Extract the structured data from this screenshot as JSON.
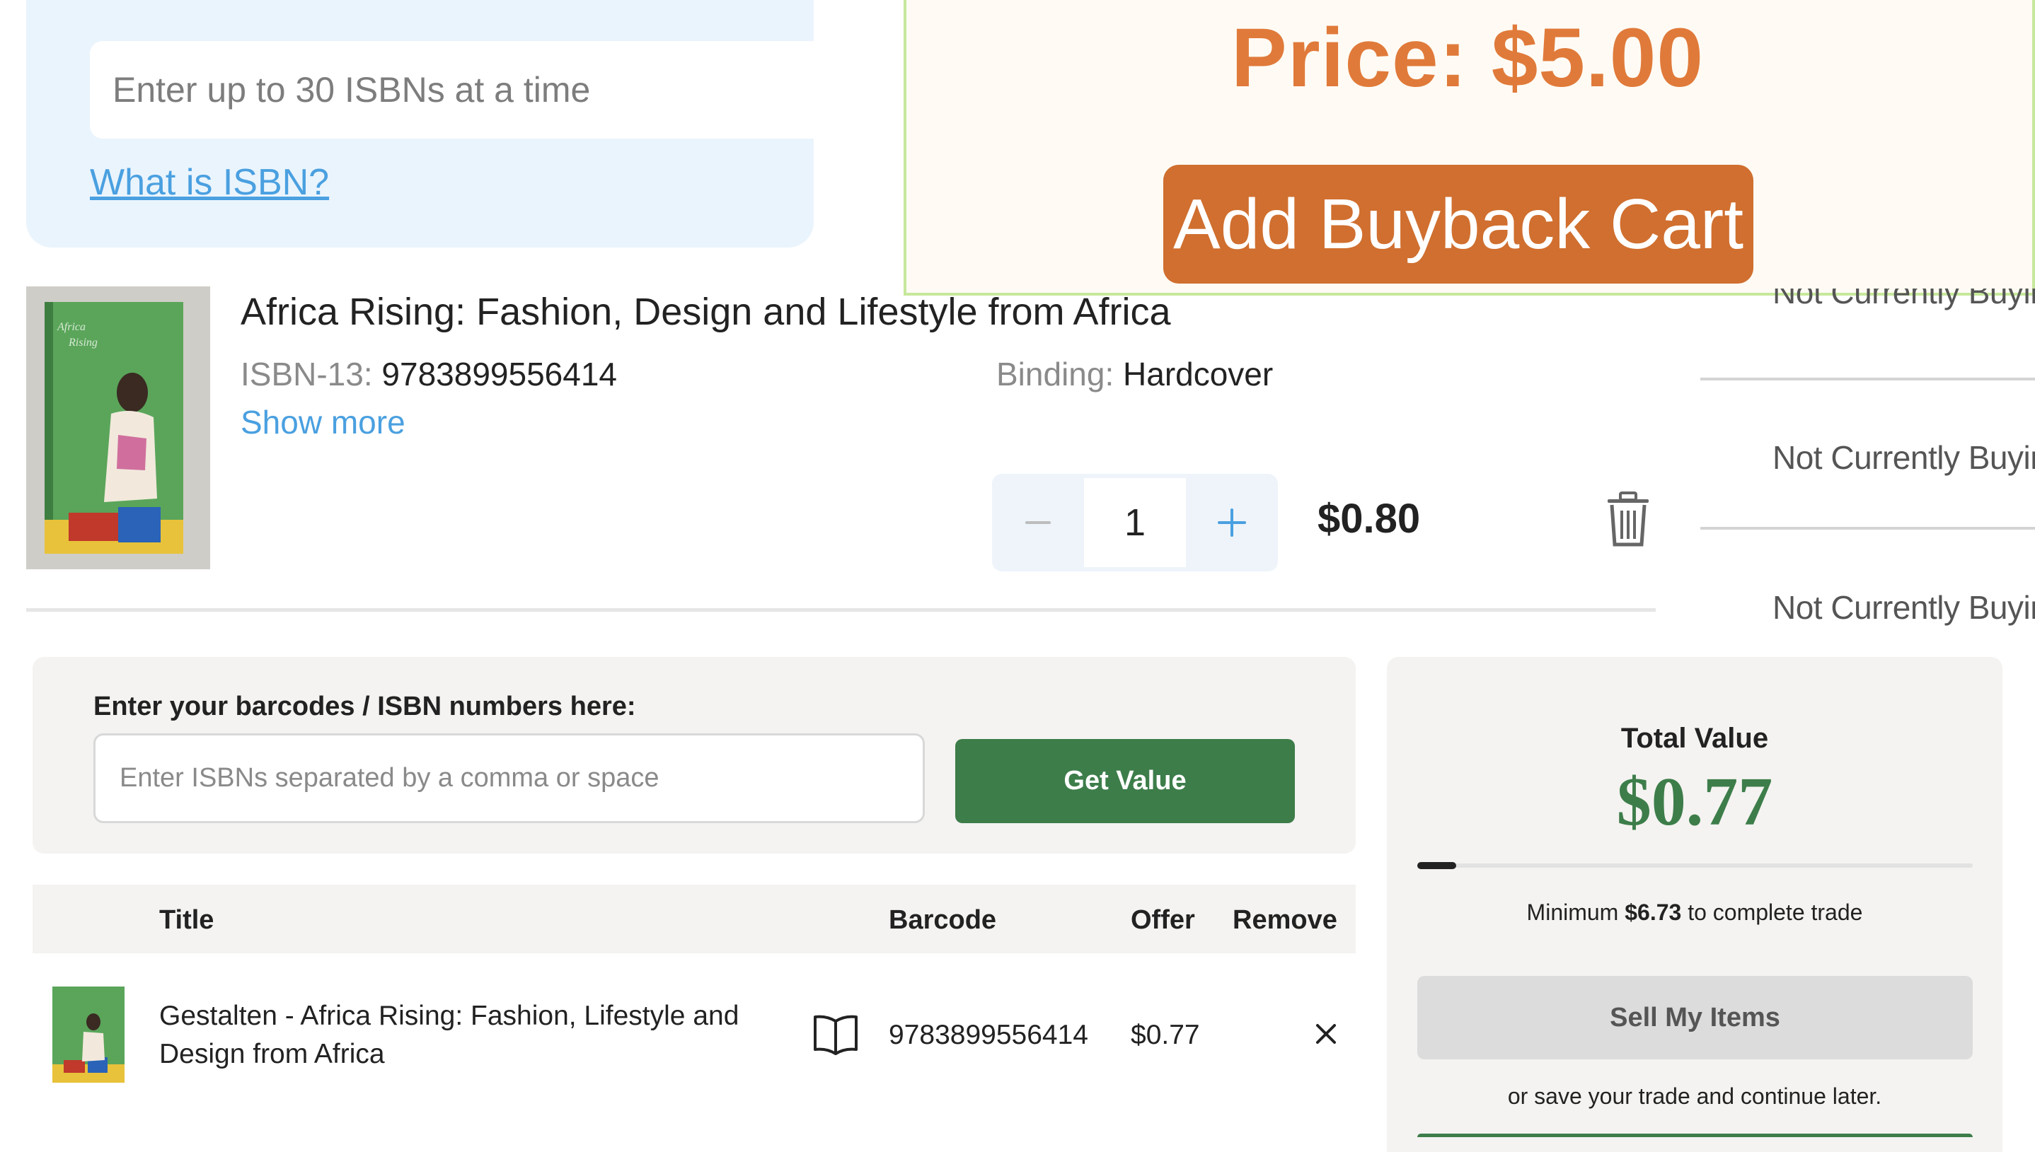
{
  "isbn_panel": {
    "input_placeholder": "Enter up to 30 ISBNs at a time",
    "help_link": "What is ISBN?"
  },
  "price_overlay": {
    "price_text": "Price: $5.00",
    "add_button_label": "Add Buyback Cart"
  },
  "product": {
    "title": "Africa Rising: Fashion, Design and Lifestyle from Africa",
    "isbn_label": "ISBN-13:",
    "isbn_value": "9783899556414",
    "binding_label": "Binding:",
    "binding_value": "Hardcover",
    "show_more": "Show more",
    "quantity": "1",
    "minus_symbol": "−",
    "plus_symbol": "+",
    "price": "$0.80",
    "trash_icon": "trash-icon"
  },
  "buy_status": {
    "items": [
      "Not Currently Buying",
      "Not Currently Buying",
      "Not Currently Buying"
    ]
  },
  "barcode_entry": {
    "label": "Enter your barcodes / ISBN numbers here:",
    "placeholder": "Enter ISBNs separated by a comma or space",
    "button_label": "Get Value"
  },
  "items_table": {
    "headers": {
      "title": "Title",
      "barcode": "Barcode",
      "offer": "Offer",
      "remove": "Remove"
    },
    "rows": [
      {
        "title": "Gestalten - Africa Rising: Fashion, Lifestyle and Design from Africa",
        "barcode": "9783899556414",
        "offer": "$0.77",
        "icon": "book-icon",
        "remove_icon": "close-icon"
      }
    ]
  },
  "summary": {
    "total_label": "Total Value",
    "total_amount": "$0.77",
    "progress_fraction": 0.07,
    "minimum_prefix": "Minimum",
    "minimum_amount": "$6.73",
    "minimum_suffix": "to complete trade",
    "sell_button": "Sell My Items",
    "save_text": "or save your trade and continue later."
  },
  "colors": {
    "accent_orange": "#d06f2f",
    "price_orange": "#e07a3a",
    "link_blue": "#4aa0e0",
    "brand_green": "#3d7d4a",
    "panel_blue": "#eaf4fd",
    "card_gray": "#f4f3f1"
  }
}
